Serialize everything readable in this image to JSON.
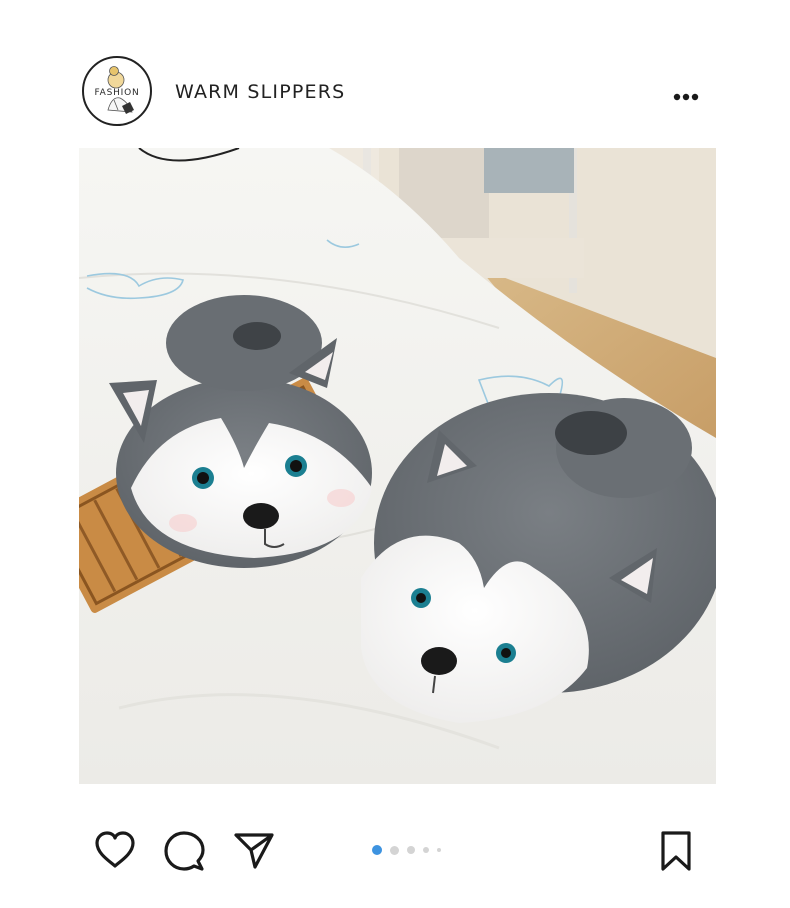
{
  "post": {
    "account_name": "WARM SLIPPERS",
    "avatar_text": "FASHION",
    "more_icon": "more-horizontal-icon",
    "image_alt": "Husky slippers on bed",
    "carousel": {
      "total": 5,
      "active_index": 0,
      "active_color": "#3d93e0",
      "inactive_color": "#d4d4d4"
    }
  },
  "actions": {
    "like_icon": "heart-icon",
    "comment_icon": "comment-icon",
    "share_icon": "send-icon",
    "save_icon": "bookmark-icon"
  }
}
